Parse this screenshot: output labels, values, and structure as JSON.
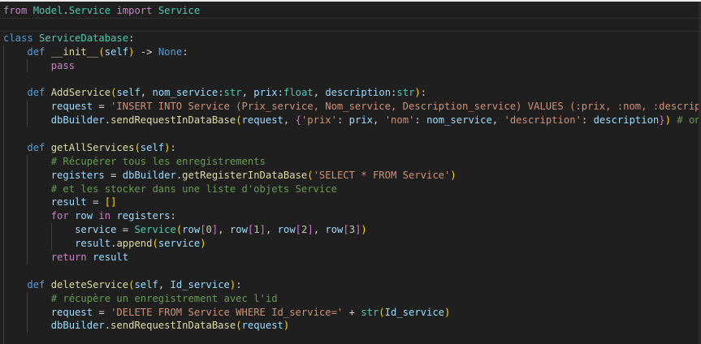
{
  "editor": {
    "language": "python",
    "colors": {
      "background": "#1f1f1f",
      "keyword": "#569cd6",
      "control": "#c586c0",
      "function": "#dcdcaa",
      "class": "#4ec9b0",
      "variable": "#9cdcfe",
      "string": "#ce9178",
      "comment": "#6a9955",
      "number": "#b5cea8",
      "text": "#d4d4d4"
    },
    "lines": [
      {
        "indent": 0,
        "tokens": [
          [
            "ctl",
            "from"
          ],
          [
            "txt",
            " "
          ],
          [
            "cls",
            "Model"
          ],
          [
            "txt",
            "."
          ],
          [
            "cls",
            "Service"
          ],
          [
            "txt",
            " "
          ],
          [
            "ctl",
            "import"
          ],
          [
            "txt",
            " "
          ],
          [
            "cls",
            "Service"
          ]
        ]
      },
      {
        "indent": 0,
        "tokens": []
      },
      {
        "indent": 0,
        "tokens": [
          [
            "kw",
            "class"
          ],
          [
            "txt",
            " "
          ],
          [
            "cls",
            "ServiceDatabase"
          ],
          [
            "txt",
            ":"
          ]
        ]
      },
      {
        "indent": 1,
        "tokens": [
          [
            "kw",
            "def"
          ],
          [
            "txt",
            " "
          ],
          [
            "fn",
            "__init__"
          ],
          [
            "br1",
            "("
          ],
          [
            "var",
            "self"
          ],
          [
            "br1",
            ")"
          ],
          [
            "txt",
            " -> "
          ],
          [
            "kw",
            "None"
          ],
          [
            "txt",
            ":"
          ]
        ]
      },
      {
        "indent": 2,
        "tokens": [
          [
            "ctl",
            "pass"
          ]
        ]
      },
      {
        "indent": 1,
        "tokens": []
      },
      {
        "indent": 1,
        "tokens": [
          [
            "kw",
            "def"
          ],
          [
            "txt",
            " "
          ],
          [
            "fn",
            "AddService"
          ],
          [
            "br1",
            "("
          ],
          [
            "var",
            "self"
          ],
          [
            "txt",
            ", "
          ],
          [
            "var",
            "nom_service"
          ],
          [
            "txt",
            ":"
          ],
          [
            "cls",
            "str"
          ],
          [
            "txt",
            ", "
          ],
          [
            "var",
            "prix"
          ],
          [
            "txt",
            ":"
          ],
          [
            "cls",
            "float"
          ],
          [
            "txt",
            ", "
          ],
          [
            "var",
            "description"
          ],
          [
            "txt",
            ":"
          ],
          [
            "cls",
            "str"
          ],
          [
            "br1",
            ")"
          ],
          [
            "txt",
            ":"
          ]
        ]
      },
      {
        "indent": 2,
        "tokens": [
          [
            "var",
            "request"
          ],
          [
            "txt",
            " = "
          ],
          [
            "str",
            "'INSERT INTO Service (Prix_service, Nom_service, Description_service) VALUES (:prix, :nom, :description)'"
          ]
        ]
      },
      {
        "indent": 2,
        "tokens": [
          [
            "var",
            "dbBuilder"
          ],
          [
            "txt",
            "."
          ],
          [
            "fn",
            "sendRequestInDataBase"
          ],
          [
            "br1",
            "("
          ],
          [
            "var",
            "request"
          ],
          [
            "txt",
            ", "
          ],
          [
            "br2",
            "{"
          ],
          [
            "str",
            "'prix'"
          ],
          [
            "txt",
            ": "
          ],
          [
            "var",
            "prix"
          ],
          [
            "txt",
            ", "
          ],
          [
            "str",
            "'nom'"
          ],
          [
            "txt",
            ": "
          ],
          [
            "var",
            "nom_service"
          ],
          [
            "txt",
            ", "
          ],
          [
            "str",
            "'description'"
          ],
          [
            "txt",
            ": "
          ],
          [
            "var",
            "description"
          ],
          [
            "br2",
            "}"
          ],
          [
            "br1",
            ")"
          ],
          [
            "txt",
            " "
          ],
          [
            "cmt",
            "# on envoie l"
          ]
        ]
      },
      {
        "indent": 1,
        "tokens": []
      },
      {
        "indent": 1,
        "tokens": [
          [
            "kw",
            "def"
          ],
          [
            "txt",
            " "
          ],
          [
            "fn",
            "getAllServices"
          ],
          [
            "br1",
            "("
          ],
          [
            "var",
            "self"
          ],
          [
            "br1",
            ")"
          ],
          [
            "txt",
            ":"
          ]
        ]
      },
      {
        "indent": 2,
        "tokens": [
          [
            "cmt",
            "# Récupérer tous les enregistrements"
          ]
        ]
      },
      {
        "indent": 2,
        "tokens": [
          [
            "var",
            "registers"
          ],
          [
            "txt",
            " = "
          ],
          [
            "var",
            "dbBuilder"
          ],
          [
            "txt",
            "."
          ],
          [
            "fn",
            "getRegisterInDataBase"
          ],
          [
            "br1",
            "("
          ],
          [
            "str",
            "'SELECT * FROM Service'"
          ],
          [
            "br1",
            ")"
          ]
        ]
      },
      {
        "indent": 2,
        "tokens": [
          [
            "cmt",
            "# et les stocker dans une liste d'objets Service"
          ]
        ]
      },
      {
        "indent": 2,
        "tokens": [
          [
            "var",
            "result"
          ],
          [
            "txt",
            " = "
          ],
          [
            "br1",
            "[]"
          ]
        ]
      },
      {
        "indent": 2,
        "tokens": [
          [
            "ctl",
            "for"
          ],
          [
            "txt",
            " "
          ],
          [
            "var",
            "row"
          ],
          [
            "txt",
            " "
          ],
          [
            "ctl",
            "in"
          ],
          [
            "txt",
            " "
          ],
          [
            "var",
            "registers"
          ],
          [
            "txt",
            ":"
          ]
        ]
      },
      {
        "indent": 3,
        "tokens": [
          [
            "var",
            "service"
          ],
          [
            "txt",
            " = "
          ],
          [
            "cls",
            "Service"
          ],
          [
            "br1",
            "("
          ],
          [
            "var",
            "row"
          ],
          [
            "br2",
            "["
          ],
          [
            "num",
            "0"
          ],
          [
            "br2",
            "]"
          ],
          [
            "txt",
            ", "
          ],
          [
            "var",
            "row"
          ],
          [
            "br2",
            "["
          ],
          [
            "num",
            "1"
          ],
          [
            "br2",
            "]"
          ],
          [
            "txt",
            ", "
          ],
          [
            "var",
            "row"
          ],
          [
            "br2",
            "["
          ],
          [
            "num",
            "2"
          ],
          [
            "br2",
            "]"
          ],
          [
            "txt",
            ", "
          ],
          [
            "var",
            "row"
          ],
          [
            "br2",
            "["
          ],
          [
            "num",
            "3"
          ],
          [
            "br2",
            "]"
          ],
          [
            "br1",
            ")"
          ]
        ]
      },
      {
        "indent": 3,
        "tokens": [
          [
            "var",
            "result"
          ],
          [
            "txt",
            "."
          ],
          [
            "fn",
            "append"
          ],
          [
            "br1",
            "("
          ],
          [
            "var",
            "service"
          ],
          [
            "br1",
            ")"
          ]
        ]
      },
      {
        "indent": 2,
        "tokens": [
          [
            "ctl",
            "return"
          ],
          [
            "txt",
            " "
          ],
          [
            "var",
            "result"
          ]
        ]
      },
      {
        "indent": 1,
        "tokens": []
      },
      {
        "indent": 1,
        "tokens": [
          [
            "kw",
            "def"
          ],
          [
            "txt",
            " "
          ],
          [
            "fn",
            "deleteService"
          ],
          [
            "br1",
            "("
          ],
          [
            "var",
            "self"
          ],
          [
            "txt",
            ", "
          ],
          [
            "var",
            "Id_service"
          ],
          [
            "br1",
            ")"
          ],
          [
            "txt",
            ":"
          ]
        ]
      },
      {
        "indent": 2,
        "tokens": [
          [
            "cmt",
            "# récupère un enregistrement avec l'id"
          ]
        ]
      },
      {
        "indent": 2,
        "tokens": [
          [
            "var",
            "request"
          ],
          [
            "txt",
            " = "
          ],
          [
            "str",
            "'DELETE FROM Service WHERE Id_service='"
          ],
          [
            "txt",
            " + "
          ],
          [
            "cls",
            "str"
          ],
          [
            "br1",
            "("
          ],
          [
            "var",
            "Id_service"
          ],
          [
            "br1",
            ")"
          ]
        ]
      },
      {
        "indent": 2,
        "tokens": [
          [
            "var",
            "dbBuilder"
          ],
          [
            "txt",
            "."
          ],
          [
            "fn",
            "sendRequestInDataBase"
          ],
          [
            "br1",
            "("
          ],
          [
            "var",
            "request"
          ],
          [
            "br1",
            ")"
          ]
        ]
      },
      {
        "indent": 1,
        "tokens": []
      }
    ]
  }
}
